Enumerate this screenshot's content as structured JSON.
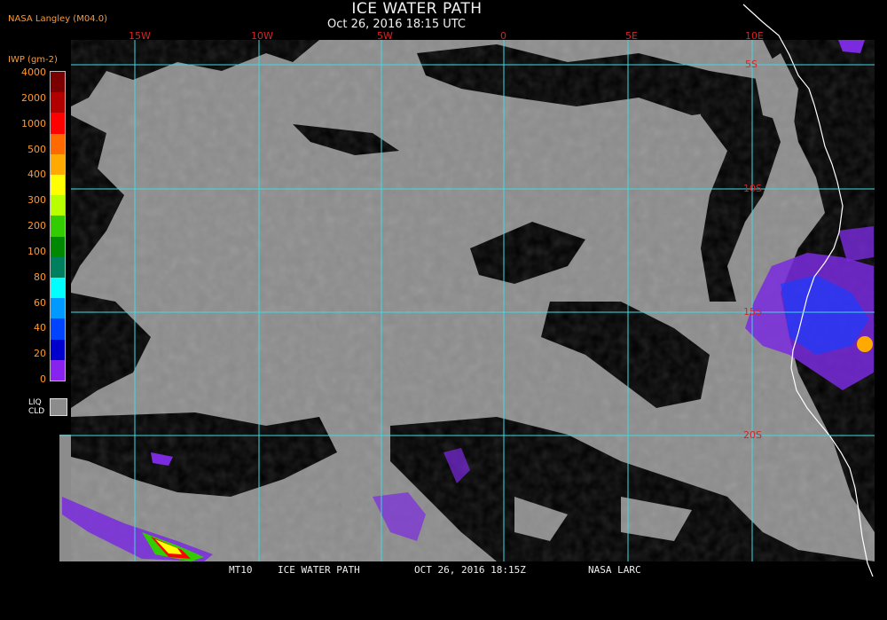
{
  "header": {
    "title": "ICE WATER PATH",
    "subtitle": "Oct 26, 2016 18:15 UTC",
    "producer": "NASA Langley (M04.0)"
  },
  "legend": {
    "title": "IWP (gm-2)",
    "labels": [
      "4000",
      "2000",
      "1000",
      "500",
      "400",
      "300",
      "200",
      "100",
      "80",
      "60",
      "40",
      "20",
      "0"
    ],
    "colors": [
      "#7a0000",
      "#b00000",
      "#ff0000",
      "#ff6a00",
      "#ffaa00",
      "#ffff00",
      "#b8ff00",
      "#33cc00",
      "#008800",
      "#007f5f",
      "#00ffff",
      "#0099ff",
      "#0044ff",
      "#0000cc",
      "#8822ee"
    ],
    "liquid_cloud_label": [
      "LIQ",
      "CLD"
    ],
    "liquid_cloud_color": "#8c8c8c"
  },
  "map": {
    "longitude_labels": [
      "15W",
      "10W",
      "5W",
      "0",
      "5E",
      "10E"
    ],
    "latitude_labels": [
      "5S",
      "10S",
      "15S",
      "20S"
    ],
    "colors": {
      "liquid_cloud": "#8c8c8c",
      "clear": "#000000",
      "grid": "#40d8e0",
      "coast": "#ffffff",
      "grid_label": "#dd2222"
    }
  },
  "footer": {
    "sat": "MT10",
    "product": "ICE WATER PATH",
    "datetime": "OCT 26, 2016 18:15Z",
    "agency": "NASA LARC"
  }
}
